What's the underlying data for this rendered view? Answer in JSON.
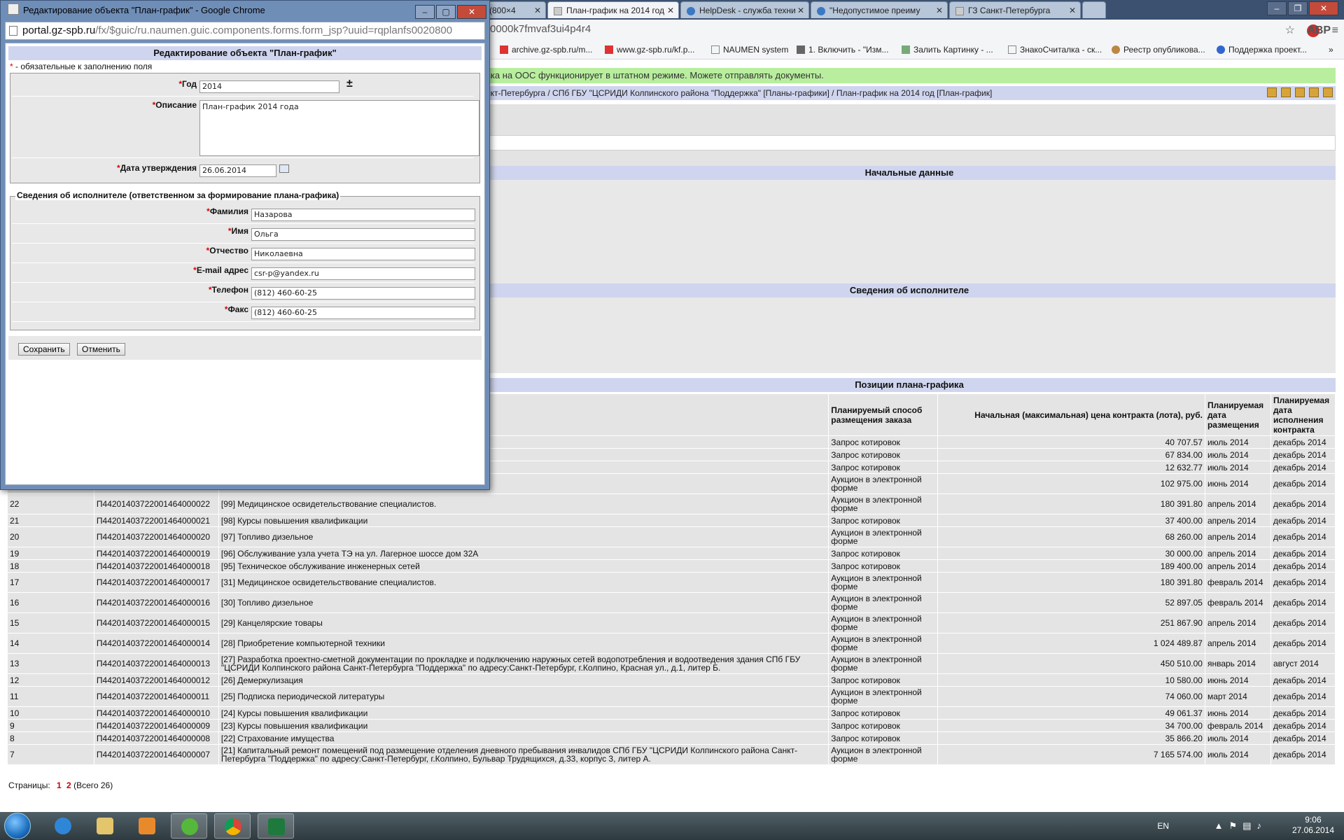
{
  "browser": {
    "tabs": [
      {
        "label": "g (800×4"
      },
      {
        "label": "План-график на 2014 год"
      },
      {
        "label": "HelpDesk - служба техни"
      },
      {
        "label": "\"Недопустимое преиму"
      },
      {
        "label": "ГЗ Санкт-Петербурга"
      }
    ],
    "url_tail": "0000k7fmvaf3ui4p4r4",
    "bookmarks": [
      "archive.gz-spb.ru/m...",
      "www.gz-spb.ru/kf.p...",
      "NAUMEN system",
      "1. Включить - \"Изм...",
      "Залить Картинку - ...",
      "ЗнакоСчиталка - ск...",
      "Реестр опубликова...",
      "Поддержка проект..."
    ],
    "abp_label": "ABP"
  },
  "page": {
    "notice": "вка на ООС функционирует в штатном режиме. Можете отправлять документы.",
    "breadcrumb": "нкт-Петербурга / СПб ГБУ \"ЦСРИДИ Колпинского района \"Поддержка\" [Планы-графики] / План-график на 2014 год [План-график]",
    "section1": "Начальные данные",
    "section2": "Сведения об исполнителе",
    "section3": "Позиции плана-графика",
    "table_headers": [
      "",
      "",
      "",
      "Планируемый способ размещения заказа",
      "Начальная (максимальная) цена контракта (лота), руб.",
      "Планируемая дата размещения",
      "Планируемая дата исполнения контракта"
    ],
    "rows": [
      {
        "n": "",
        "code": "",
        "name": "",
        "method": "Запрос котировок",
        "price": "40 707.57",
        "date": "июль 2014",
        "end": "декабрь 2014"
      },
      {
        "n": "",
        "code": "",
        "name": "",
        "method": "Запрос котировок",
        "price": "67 834.00",
        "date": "июль 2014",
        "end": "декабрь 2014"
      },
      {
        "n": "",
        "code": "",
        "name": "",
        "method": "Запрос котировок",
        "price": "12 632.77",
        "date": "июль 2014",
        "end": "декабрь 2014"
      },
      {
        "n": "",
        "code": "",
        "name": "",
        "method": "Аукцион в электронной форме",
        "price": "102 975.00",
        "date": "июнь 2014",
        "end": "декабрь 2014"
      },
      {
        "n": "22",
        "code": "П44201403722001464000022",
        "name": "[99] Медицинское освидетельствование специалистов.",
        "method": "Аукцион в электронной форме",
        "price": "180 391.80",
        "date": "апрель 2014",
        "end": "декабрь 2014"
      },
      {
        "n": "21",
        "code": "П44201403722001464000021",
        "name": "[98] Курсы повышения квалификации",
        "method": "Запрос котировок",
        "price": "37 400.00",
        "date": "апрель 2014",
        "end": "декабрь 2014"
      },
      {
        "n": "20",
        "code": "П44201403722001464000020",
        "name": "[97] Топливо дизельное",
        "method": "Аукцион в электронной форме",
        "price": "68 260.00",
        "date": "апрель 2014",
        "end": "декабрь 2014"
      },
      {
        "n": "19",
        "code": "П44201403722001464000019",
        "name": "[96] Обслуживание узла учета ТЭ на ул. Лагерное шоссе дом 32А",
        "method": "Запрос котировок",
        "price": "30 000.00",
        "date": "апрель 2014",
        "end": "декабрь 2014"
      },
      {
        "n": "18",
        "code": "П44201403722001464000018",
        "name": "[95] Техническое обслуживание инженерных сетей",
        "method": "Запрос котировок",
        "price": "189 400.00",
        "date": "апрель 2014",
        "end": "декабрь 2014"
      },
      {
        "n": "17",
        "code": "П44201403722001464000017",
        "name": "[31] Медицинское освидетельствование специалистов.",
        "method": "Аукцион в электронной форме",
        "price": "180 391.80",
        "date": "февраль 2014",
        "end": "декабрь 2014"
      },
      {
        "n": "16",
        "code": "П44201403722001464000016",
        "name": "[30] Топливо дизельное",
        "method": "Аукцион в электронной форме",
        "price": "52 897.05",
        "date": "февраль 2014",
        "end": "декабрь 2014"
      },
      {
        "n": "15",
        "code": "П44201403722001464000015",
        "name": "[29] Канцелярские товары",
        "method": "Аукцион в электронной форме",
        "price": "251 867.90",
        "date": "апрель 2014",
        "end": "декабрь 2014"
      },
      {
        "n": "14",
        "code": "П44201403722001464000014",
        "name": "[28] Приобретение компьютерной техники",
        "method": "Аукцион в электронной форме",
        "price": "1 024 489.87",
        "date": "апрель 2014",
        "end": "декабрь 2014"
      },
      {
        "n": "13",
        "code": "П44201403722001464000013",
        "name": "[27] Разработка проектно-сметной документации по прокладке и подключению наружных сетей водопотребления и водоотведения здания СПб ГБУ \"ЦСРИДИ Колпинского района Санкт-Петербурга \"Поддержка\" по адресу:Санкт-Петербург, г.Колпино, Красная ул., д.1, литер Б.",
        "method": "Аукцион в электронной форме",
        "price": "450 510.00",
        "date": "январь 2014",
        "end": "август 2014"
      },
      {
        "n": "12",
        "code": "П44201403722001464000012",
        "name": "[26] Демеркулизация",
        "method": "Запрос котировок",
        "price": "10 580.00",
        "date": "июнь 2014",
        "end": "декабрь 2014"
      },
      {
        "n": "11",
        "code": "П44201403722001464000011",
        "name": "[25] Подписка периодической литературы",
        "method": "Аукцион в электронной форме",
        "price": "74 060.00",
        "date": "март 2014",
        "end": "декабрь 2014"
      },
      {
        "n": "10",
        "code": "П44201403722001464000010",
        "name": "[24] Курсы повышения квалификации",
        "method": "Запрос котировок",
        "price": "49 061.37",
        "date": "июнь 2014",
        "end": "декабрь 2014"
      },
      {
        "n": "9",
        "code": "П44201403722001464000009",
        "name": "[23] Курсы повышения квалификации",
        "method": "Запрос котировок",
        "price": "34 700.00",
        "date": "февраль 2014",
        "end": "декабрь 2014"
      },
      {
        "n": "8",
        "code": "П44201403722001464000008",
        "name": "[22] Страхование имущества",
        "method": "Запрос котировок",
        "price": "35 866.20",
        "date": "июль 2014",
        "end": "декабрь 2014"
      },
      {
        "n": "7",
        "code": "П44201403722001464000007",
        "name": "[21] Капитальный ремонт помещений под размещение отделения дневного пребывания инвалидов СПб ГБУ \"ЦСРИДИ Колпинского района Санкт-Петербурга \"Поддержка\" по адресу:Санкт-Петербург, г.Колпино, Бульвар Трудящихся, д.33, корпус 3, литер А.",
        "method": "Аукцион в электронной форме",
        "price": "7 165 574.00",
        "date": "июль 2014",
        "end": "декабрь 2014"
      }
    ],
    "pager": {
      "label": "Страницы:",
      "p1": "1",
      "p2": "2",
      "total": "(Всего 26)"
    }
  },
  "popup": {
    "window_title": "Редактирование объекта \"План-график\" - Google Chrome",
    "url_main": "portal.gz-spb.ru",
    "url_rest": "/fx/$guic/ru.naumen.guic.components.forms.form_jsp?uuid=rqplanfs0020800",
    "form_title": "Редактирование объекта \"План-график\"",
    "required_note": " - обязательные к заполнению поля",
    "fields": {
      "year_label": "Год",
      "year_value": "2014",
      "desc_label": "Описание",
      "desc_value": "План-график 2014 года",
      "date_label": "Дата утверждения",
      "date_value": "26.06.2014"
    },
    "executor_legend": "Сведения об исполнителе (ответственном за формирование плана-графика)",
    "executor": {
      "lastname_label": "Фамилия",
      "lastname_value": "Назарова",
      "firstname_label": "Имя",
      "firstname_value": "Ольга",
      "middlename_label": "Отчество",
      "middlename_value": "Николаевна",
      "email_label": "E-mail адрес",
      "email_value": "csr-p@yandex.ru",
      "phone_label": "Телефон",
      "phone_value": "(812) 460-60-25",
      "fax_label": "Факс",
      "fax_value": "(812) 460-60-25"
    },
    "save_label": "Сохранить",
    "cancel_label": "Отменить"
  },
  "taskbar": {
    "lang": "EN",
    "time": "9:06",
    "date": "27.06.2014"
  },
  "colors": {
    "accent": "#cfd5ee",
    "notice": "#b8ee9e",
    "required": "#dd0000"
  }
}
